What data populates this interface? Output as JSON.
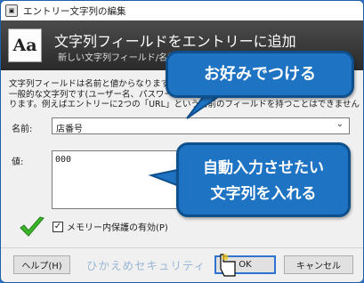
{
  "window": {
    "title": "エントリー文字列の編集"
  },
  "header": {
    "icon_text": "Aa",
    "title": "文字列フィールドをエントリーに追加",
    "subtitle": "新しい文字列フィールド/名前をこのエントリーに追加します"
  },
  "description": {
    "lines": [
      "文字列フィールドは名前と値からなります。文字列フィールドは他のエントリーの",
      "一般的な文字列です(ユーザー名、パスワードなど)。これらは、フィールドでも",
      "ります。例えばエントリーに2つの「URL」という名前のフィールドを持つことはできません"
    ]
  },
  "form": {
    "name_label": "名前:",
    "name_value": "店番号",
    "value_label": "値:",
    "value_text": "000"
  },
  "protect": {
    "checked_glyph": "✓",
    "label": "メモリー内保護の有効(P)"
  },
  "buttons": {
    "help": "ヘルプ(H)",
    "ok": "OK",
    "cancel": "キャンセル"
  },
  "watermark": "ひかえめセキュリティ",
  "callouts": {
    "top": "お好みでつける",
    "bottom_line1": "自動入力させたい",
    "bottom_line2": "文字列を入れる"
  },
  "colors": {
    "callout_fill": "#1e73c3",
    "callout_border": "#0e4f8c",
    "header_bg": "#333333",
    "ok_border": "#2f73d0",
    "check_green": "#3cb82b"
  },
  "icons": {
    "window": "keepass-window-icon",
    "header": "text-aa-icon",
    "name_dropdown": "chevron-down-icon",
    "check": "green-check-icon",
    "cursor": "mouse-pointer-icon"
  }
}
